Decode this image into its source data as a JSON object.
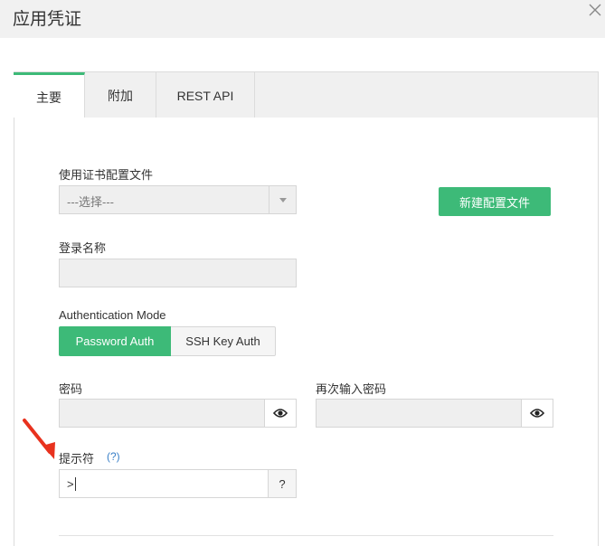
{
  "dialog": {
    "title": "应用凭证",
    "close_icon": "close-icon"
  },
  "tabs": [
    {
      "label": "主要",
      "active": true
    },
    {
      "label": "附加",
      "active": false
    },
    {
      "label": "REST API",
      "active": false
    }
  ],
  "form": {
    "profile": {
      "label": "使用证书配置文件",
      "selected": "---选择---",
      "new_button": "新建配置文件"
    },
    "login_name": {
      "label": "登录名称",
      "value": ""
    },
    "auth_mode": {
      "label": "Authentication Mode",
      "options": [
        "Password Auth",
        "SSH Key Auth"
      ],
      "selected": "Password Auth"
    },
    "password": {
      "label": "密码",
      "value": "",
      "icon": "eye-icon"
    },
    "password_confirm": {
      "label": "再次输入密码",
      "value": "",
      "icon": "eye-icon"
    },
    "prompt": {
      "label": "提示符",
      "help_link": "(?)",
      "value": ">",
      "help_button": "?"
    }
  },
  "colors": {
    "accent": "#3dba78",
    "link": "#3a80c8",
    "annotation": "#e8321e"
  }
}
